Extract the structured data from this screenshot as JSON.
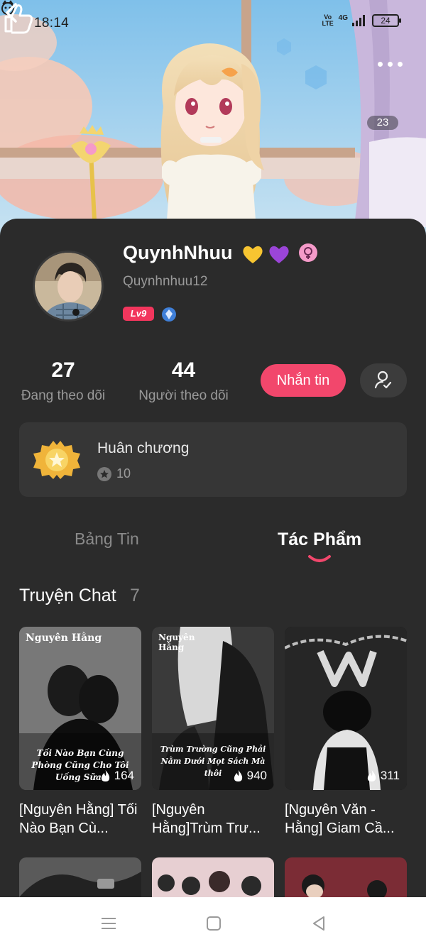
{
  "status_bar": {
    "time": "18:14",
    "network_volte": "Vo LTE",
    "network_type": "4G",
    "battery": "24"
  },
  "hero": {
    "like_count": "23"
  },
  "profile": {
    "display_name": "QuynhNhuu",
    "name_emojis": [
      "yellow-heart",
      "purple-heart"
    ],
    "username": "Quynhnhuu12",
    "level": "Lv9",
    "following_count": "27",
    "following_label": "Đang theo dõi",
    "followers_count": "44",
    "followers_label": "Người theo dõi",
    "message_label": "Nhắn tin"
  },
  "medal": {
    "title": "Huân chương",
    "count": "10"
  },
  "tabs": [
    {
      "label": "Bảng Tin",
      "active": false
    },
    {
      "label": "Tác Phẩm",
      "active": true
    }
  ],
  "section": {
    "title": "Truyện Chat",
    "count": "7"
  },
  "stories": [
    {
      "cover_author": "Nguyên Hằng",
      "cover_caption": "Tối Nào Bạn Cùng Phòng Cũng Cho Tôi Uống Sữa!",
      "views": "164",
      "title": "[Nguyên Hằng] Tối Nào Bạn Cù..."
    },
    {
      "cover_author": "Nguyên Hằng",
      "cover_caption": "Trùm Trường Cũng Phải Nằm Dưới Mọt Sách Mà thôi",
      "views": "940",
      "title": "[Nguyên Hằng]Trùm Trư..."
    },
    {
      "cover_author": "",
      "cover_caption": "",
      "views": "311",
      "title": "[Nguyên Văn - Hằng] Giam Cầ..."
    }
  ],
  "colors": {
    "accent": "#f2476c",
    "level_badge": "#f2365d",
    "background": "#2b2b2b",
    "panel": "#363636"
  },
  "icons": [
    "back-icon",
    "more-icon",
    "thumbs-up-icon",
    "female-icon",
    "vip-diamond-icon",
    "user-check-icon",
    "medal-icon",
    "star-icon",
    "fire-icon",
    "menu-icon",
    "home-icon",
    "back-triangle-icon"
  ]
}
